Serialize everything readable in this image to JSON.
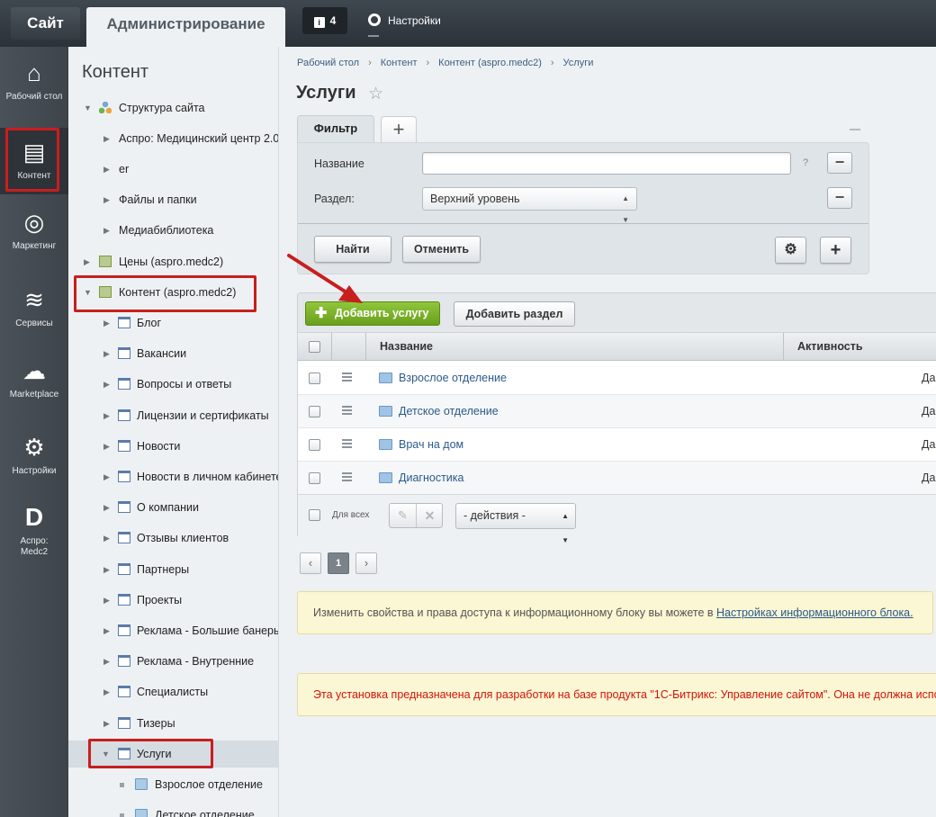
{
  "topbar": {
    "tab_site": "Сайт",
    "tab_admin": "Администрирование",
    "notifications_count": "4",
    "settings_label": "Настройки"
  },
  "iconmenu": [
    {
      "label": "Рабочий стол",
      "icon": "home-icon"
    },
    {
      "label": "Контент",
      "icon": "document-icon"
    },
    {
      "label": "Маркетинг",
      "icon": "target-icon"
    },
    {
      "label": "Сервисы",
      "icon": "layers-icon"
    },
    {
      "label": "Marketplace",
      "icon": "cloud-download-icon"
    },
    {
      "label": "Настройки",
      "icon": "gear-icon"
    },
    {
      "label": "Аспро: Medc2",
      "icon": "aspro-logo-icon"
    }
  ],
  "tree": {
    "title": "Контент",
    "items": [
      {
        "label": "Структура сайта",
        "expanded": true
      },
      {
        "label": "Аспро: Медицинский центр 2.0"
      },
      {
        "label": "er"
      },
      {
        "label": "Файлы и папки"
      },
      {
        "label": "Медиабиблиотека"
      },
      {
        "label": "Цены (aspro.medc2)"
      },
      {
        "label": "Контент (aspro.medc2)",
        "expanded": true
      },
      {
        "label": "Блог"
      },
      {
        "label": "Вакансии"
      },
      {
        "label": "Вопросы и ответы"
      },
      {
        "label": "Лицензии и сертификаты"
      },
      {
        "label": "Новости"
      },
      {
        "label": "Новости в личном кабинете"
      },
      {
        "label": "О компании"
      },
      {
        "label": "Отзывы клиентов"
      },
      {
        "label": "Партнеры"
      },
      {
        "label": "Проекты"
      },
      {
        "label": "Реклама - Большие банеры"
      },
      {
        "label": "Реклама - Внутренние"
      },
      {
        "label": "Специалисты"
      },
      {
        "label": "Тизеры"
      },
      {
        "label": "Услуги",
        "expanded": true,
        "selected": true
      },
      {
        "label": "Взрослое отделение"
      },
      {
        "label": "Детское отделение"
      }
    ]
  },
  "breadcrumb": [
    "Рабочий стол",
    "Контент",
    "Контент (aspro.medc2)",
    "Услуги"
  ],
  "page_title": "Услуги",
  "filter": {
    "tab_label": "Фильтр",
    "add_tab": "+",
    "field_name_label": "Название",
    "field_name_value": "",
    "help": "?",
    "field_section_label": "Раздел:",
    "field_section_value": "Верхний уровень",
    "find_button": "Найти",
    "cancel_button": "Отменить",
    "remove_symbol": "−",
    "add_symbol": "+"
  },
  "toolbar": {
    "add_service": "Добавить услугу",
    "add_section": "Добавить раздел"
  },
  "grid": {
    "columns": [
      "Название",
      "Активность"
    ],
    "rows": [
      {
        "name": "Взрослое отделение",
        "active": "Да"
      },
      {
        "name": "Детское отделение",
        "active": "Да"
      },
      {
        "name": "Врач на дом",
        "active": "Да"
      },
      {
        "name": "Диагностика",
        "active": "Да"
      }
    ],
    "for_all": "Для всех",
    "actions_select": "- действия -"
  },
  "pagination": {
    "prev": "‹",
    "current": "1",
    "next": "›"
  },
  "notice_info": {
    "text": "Изменить свойства и права доступа к информационному блоку вы можете в ",
    "link": "Настройках информационного блока."
  },
  "notice_warning": "Эта установка предназначена для разработки на базе продукта \"1С-Битрикс: Управление сайтом\". Она не должна использоваться",
  "colors": {
    "accent_green": "#7ab42c",
    "highlight_red": "#c81e1e",
    "link_blue": "#2b5a8c"
  }
}
